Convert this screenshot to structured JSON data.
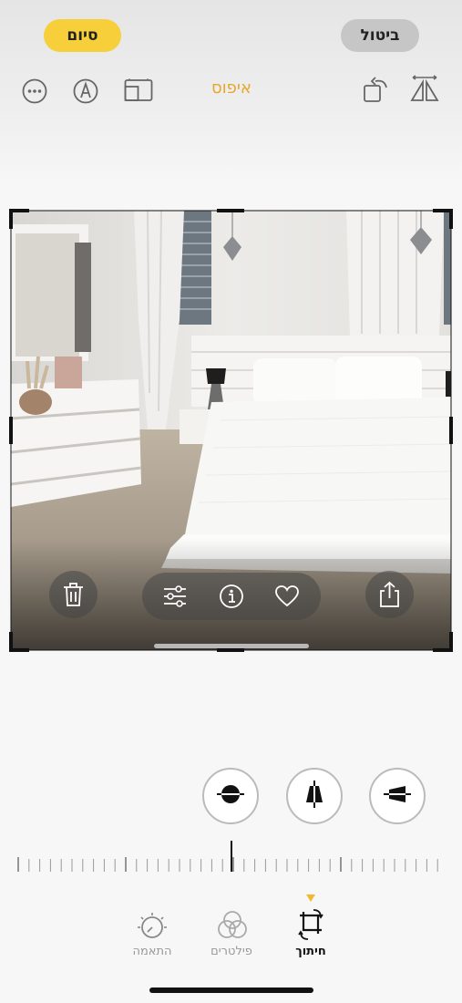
{
  "header": {
    "done_label": "סיום",
    "cancel_label": "ביטול",
    "reset_label": "איפוס"
  },
  "toolbar_icons": [
    "more-icon",
    "markup-icon",
    "aspect-ratio-icon",
    "rotate-icon",
    "flip-icon"
  ],
  "photo_overlay": {
    "icons": [
      "trash-icon",
      "adjust-icon",
      "info-icon",
      "favorite-icon",
      "share-icon"
    ]
  },
  "perspective_buttons": [
    "straighten-icon",
    "vertical-perspective-icon",
    "horizontal-perspective-icon"
  ],
  "tabs": [
    {
      "label": "התאמה"
    },
    {
      "label": "פילטרים"
    },
    {
      "label": "חיתוך"
    }
  ],
  "colors": {
    "accent": "#f7cf3a",
    "reset": "#e6a82c"
  }
}
